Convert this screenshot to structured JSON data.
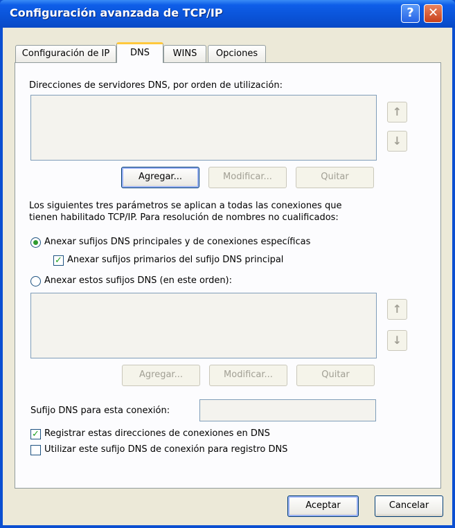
{
  "window": {
    "title": "Configuración avanzada de TCP/IP",
    "help_glyph": "?",
    "close_glyph": "✕"
  },
  "tabs": [
    {
      "label": "Configuración de IP"
    },
    {
      "label": "DNS"
    },
    {
      "label": "WINS"
    },
    {
      "label": "Opciones"
    }
  ],
  "dns": {
    "servers_label": "Direcciones de servidores DNS, por orden de utilización:",
    "servers": [],
    "add_label": "Agregar...",
    "modify_label": "Modificar...",
    "remove_label": "Quitar",
    "params_text_line1": "Los siguientes tres parámetros se aplican a todas las conexiones que",
    "params_text_line2": "tienen habilitado TCP/IP. Para resolución de nombres no cualificados:",
    "radio_primary_label": "Anexar sufijos DNS principales y de conexiones específicas",
    "radio_primary_selected": true,
    "check_parent_label": "Anexar sufijos primarios del sufijo DNS principal",
    "check_parent_checked": true,
    "radio_these_label": "Anexar estos sufijos DNS (en este orden):",
    "radio_these_selected": false,
    "suffixes": [],
    "suffix_add_label": "Agregar...",
    "suffix_modify_label": "Modificar...",
    "suffix_remove_label": "Quitar",
    "conn_suffix_label": "Sufijo DNS para esta conexión:",
    "conn_suffix_value": "",
    "register_label": "Registrar estas direcciones de conexiones en DNS",
    "register_checked": true,
    "use_suffix_label": "Utilizar este sufijo DNS de conexión para registro DNS",
    "use_suffix_checked": false
  },
  "footer": {
    "ok_label": "Aceptar",
    "cancel_label": "Cancelar"
  },
  "icons": {
    "up": "arrow-up-icon",
    "down": "arrow-down-icon"
  },
  "colors": {
    "titlebar": "#0a53d8",
    "dialog_bg": "#ece9d8",
    "panel_bg": "#fcfcfe",
    "tab_highlight": "#ffc83c",
    "check_green": "#21a121"
  }
}
